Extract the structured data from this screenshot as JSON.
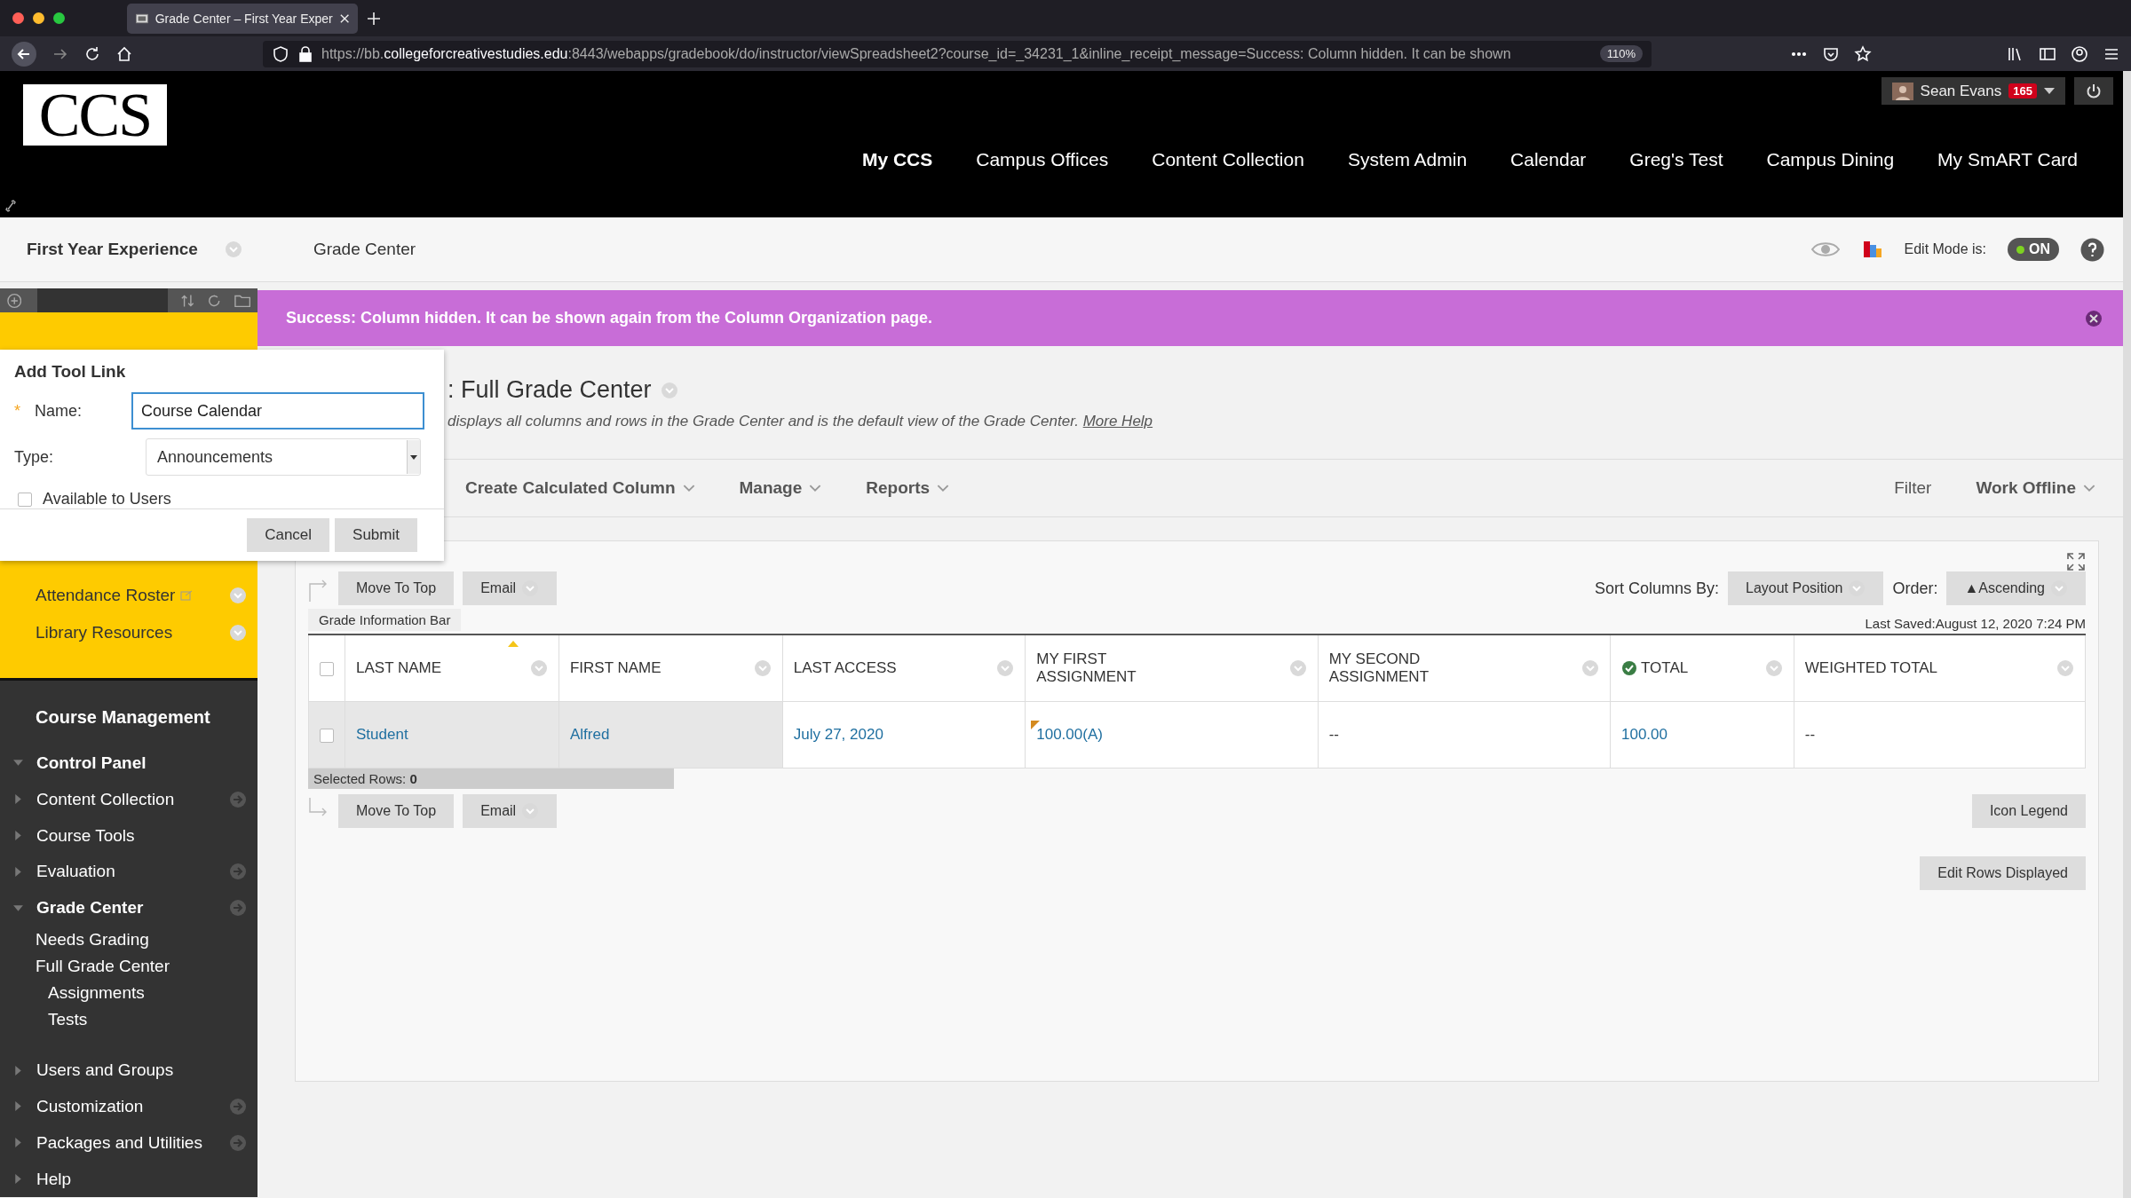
{
  "browser": {
    "tab_title": "Grade Center – First Year Exper",
    "url_host_prefix": "https://bb.",
    "url_host": "collegeforcreativestudies.edu",
    "url_rest": ":8443/webapps/gradebook/do/instructor/viewSpreadsheet2?course_id=_34231_1&inline_receipt_message=Success: Column hidden. It can be shown",
    "zoom": "110%"
  },
  "header": {
    "logo": "CCS",
    "user": {
      "name": "Sean Evans",
      "badge": "165"
    },
    "nav": [
      {
        "label": "My CCS",
        "selected": true
      },
      {
        "label": "Campus Offices",
        "selected": false
      },
      {
        "label": "Content Collection",
        "selected": false
      },
      {
        "label": "System Admin",
        "selected": false
      },
      {
        "label": "Calendar",
        "selected": false
      },
      {
        "label": "Greg's Test",
        "selected": false
      },
      {
        "label": "Campus Dining",
        "selected": false
      },
      {
        "label": "My SmART Card",
        "selected": false
      }
    ]
  },
  "breadcrumb": {
    "course": "First Year Experience",
    "page": "Grade Center",
    "edit_mode_label": "Edit Mode is:",
    "edit_mode": {
      "label": "ON",
      "on": true
    }
  },
  "course_menu": [
    {
      "label": "Attendance Roster",
      "external": true
    },
    {
      "label": "Library Resources",
      "external": false
    }
  ],
  "course_management": {
    "title": "Course Management",
    "control_panel": {
      "label": "Control Panel",
      "expanded": true,
      "children": [
        {
          "label": "Content Collection",
          "expanded": false,
          "menu": true
        },
        {
          "label": "Course Tools",
          "expanded": false,
          "menu": false
        },
        {
          "label": "Evaluation",
          "expanded": false,
          "menu": true
        },
        {
          "label": "Grade Center",
          "expanded": true,
          "menu": true,
          "children": [
            {
              "label": "Needs Grading"
            },
            {
              "label": "Full Grade Center",
              "children": [
                {
                  "label": "Assignments"
                },
                {
                  "label": "Tests"
                }
              ]
            }
          ]
        },
        {
          "label": "Users and Groups",
          "expanded": false,
          "menu": false
        },
        {
          "label": "Customization",
          "expanded": false,
          "menu": true
        },
        {
          "label": "Packages and Utilities",
          "expanded": false,
          "menu": true
        },
        {
          "label": "Help",
          "expanded": false,
          "menu": false
        }
      ]
    }
  },
  "banner": {
    "message": "Success: Column hidden. It can be shown again from the Column Organization page."
  },
  "page": {
    "title": ": Full Grade Center",
    "description": "displays all columns and rows in the Grade Center and is the default view of the Grade Center.",
    "help_link": "More Help"
  },
  "action_bar": {
    "left": [
      "Create Calculated Column",
      "Manage",
      "Reports"
    ],
    "right": [
      {
        "label": "Filter",
        "menu": false
      },
      {
        "label": "Work Offline",
        "menu": true
      }
    ]
  },
  "grid": {
    "top_buttons": [
      {
        "label": "Move To Top",
        "menu": false
      },
      {
        "label": "Email",
        "menu": true
      }
    ],
    "sort_label": "Sort Columns By:",
    "sort_value": "Layout Position",
    "order_label": "Order:",
    "order_value": "▲Ascending",
    "info_bar": "Grade Information Bar",
    "select_all": {
      "checked": false
    },
    "last_saved": "Last Saved:August 12, 2020 7:24 PM",
    "columns": [
      {
        "label": "LAST NAME",
        "sorted": true,
        "kind": "text"
      },
      {
        "label": "FIRST NAME",
        "sorted": false,
        "kind": "text"
      },
      {
        "label": "LAST ACCESS",
        "sorted": false,
        "kind": "text"
      },
      {
        "label": "MY FIRST ASSIGNMENT",
        "sorted": false,
        "kind": "text"
      },
      {
        "label": "MY SECOND ASSIGNMENT",
        "sorted": false,
        "kind": "text"
      },
      {
        "label": "TOTAL",
        "sorted": false,
        "kind": "total"
      },
      {
        "label": "WEIGHTED TOTAL",
        "sorted": false,
        "kind": "text"
      }
    ],
    "rows": [
      {
        "checked": false,
        "cells": [
          {
            "text": "Student",
            "link": true,
            "flag": false
          },
          {
            "text": "Alfred",
            "link": true,
            "flag": false
          },
          {
            "text": "July 27, 2020",
            "link": true,
            "flag": false
          },
          {
            "text": "100.00(A)",
            "link": true,
            "flag": true
          },
          {
            "text": "--",
            "link": false,
            "flag": false
          },
          {
            "text": "100.00",
            "link": true,
            "flag": false
          },
          {
            "text": "--",
            "link": false,
            "flag": false
          }
        ]
      }
    ],
    "selected_rows": "Selected Rows: **0**",
    "bottom_buttons": [
      {
        "label": "Move To Top",
        "menu": false
      },
      {
        "label": "Email",
        "menu": true
      }
    ],
    "icon_legend": "Icon Legend",
    "edit_rows": "Edit Rows Displayed"
  },
  "dialog": {
    "title": "Add Tool Link",
    "name_label": "Name:",
    "required_mark": "*",
    "name_value": "Course Calendar",
    "type_label": "Type:",
    "type_value": "Announcements",
    "available": {
      "label": "Available to Users",
      "checked": false
    },
    "buttons": [
      "Cancel",
      "Submit"
    ]
  }
}
